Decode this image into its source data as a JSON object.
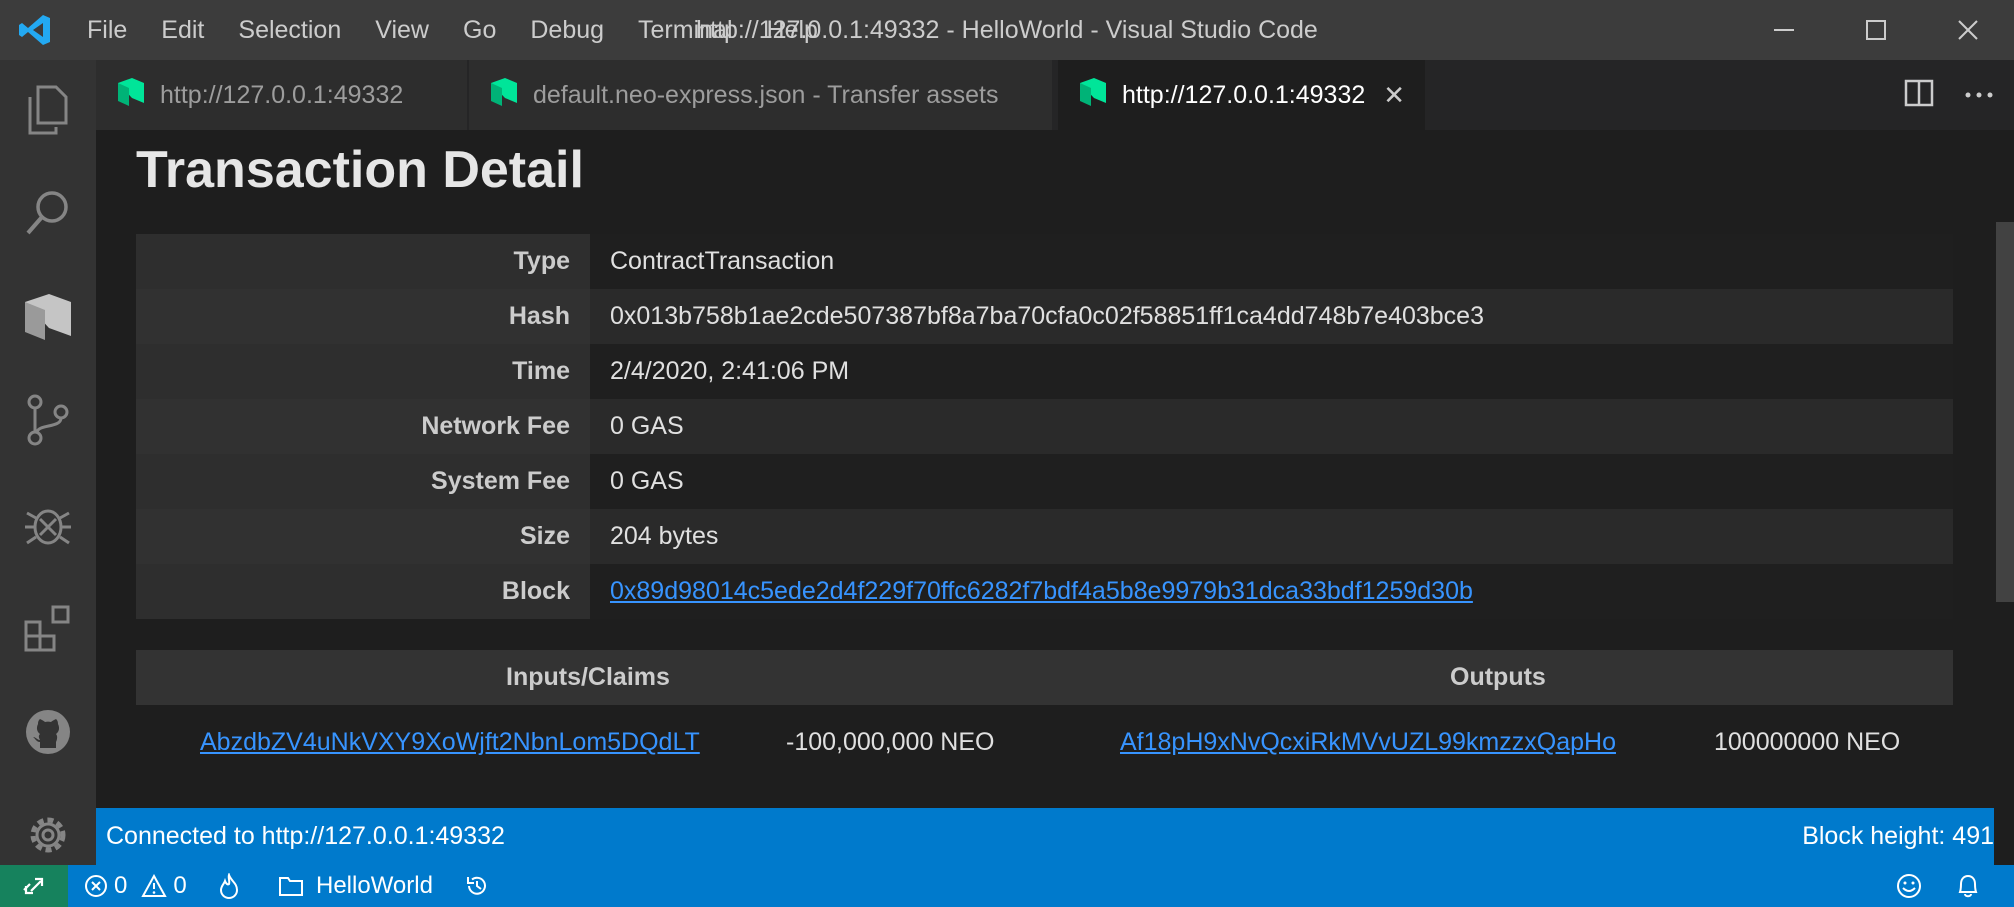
{
  "app": {
    "window_title": "http://127.0.0.1:49332 - HelloWorld - Visual Studio Code",
    "menu": [
      "File",
      "Edit",
      "Selection",
      "View",
      "Go",
      "Debug",
      "Terminal",
      "Help"
    ]
  },
  "activity": [
    "explorer-icon",
    "search-icon",
    "neo-icon",
    "source-control-icon",
    "debug-icon",
    "extensions-icon",
    "github-icon",
    "gear-icon"
  ],
  "tabs": [
    {
      "label": "http://127.0.0.1:49332",
      "active": false
    },
    {
      "label": "default.neo-express.json - Transfer assets",
      "active": false
    },
    {
      "label": "http://127.0.0.1:49332",
      "active": true
    }
  ],
  "page": {
    "title": "Transaction Detail",
    "details": [
      {
        "label": "Type",
        "value": "ContractTransaction"
      },
      {
        "label": "Hash",
        "value": "0x013b758b1ae2cde507387bf8a7ba70cfa0c02f58851ff1ca4dd748b7e403bce3"
      },
      {
        "label": "Time",
        "value": "2/4/2020, 2:41:06 PM"
      },
      {
        "label": "Network Fee",
        "value": "0 GAS"
      },
      {
        "label": "System Fee",
        "value": "0 GAS"
      },
      {
        "label": "Size",
        "value": "204 bytes"
      },
      {
        "label": "Block",
        "value": "0x89d98014c5ede2d4f229f70ffc6282f7bdf4a5b8e9979b31dca33bdf1259d30b"
      }
    ],
    "io": {
      "inputs_header": "Inputs/Claims",
      "outputs_header": "Outputs",
      "input_address": "AbzdbZV4uNkVXY9XoWjft2NbnLom5DQdLT",
      "input_amount": "-100,000,000 NEO",
      "output_address": "Af18pH9xNvQcxiRkMVvUZL99kmzzxQapHo",
      "output_amount": "100000000 NEO"
    }
  },
  "panel": {
    "connected": "Connected to http://127.0.0.1:49332",
    "block_height": "Block height: 491"
  },
  "status": {
    "errors": "0",
    "warnings": "0",
    "folder": "HelloWorld"
  },
  "colors": {
    "accent": "#007acc",
    "remote": "#16825d",
    "link": "#3794ff",
    "neo_green": "#00e599"
  }
}
